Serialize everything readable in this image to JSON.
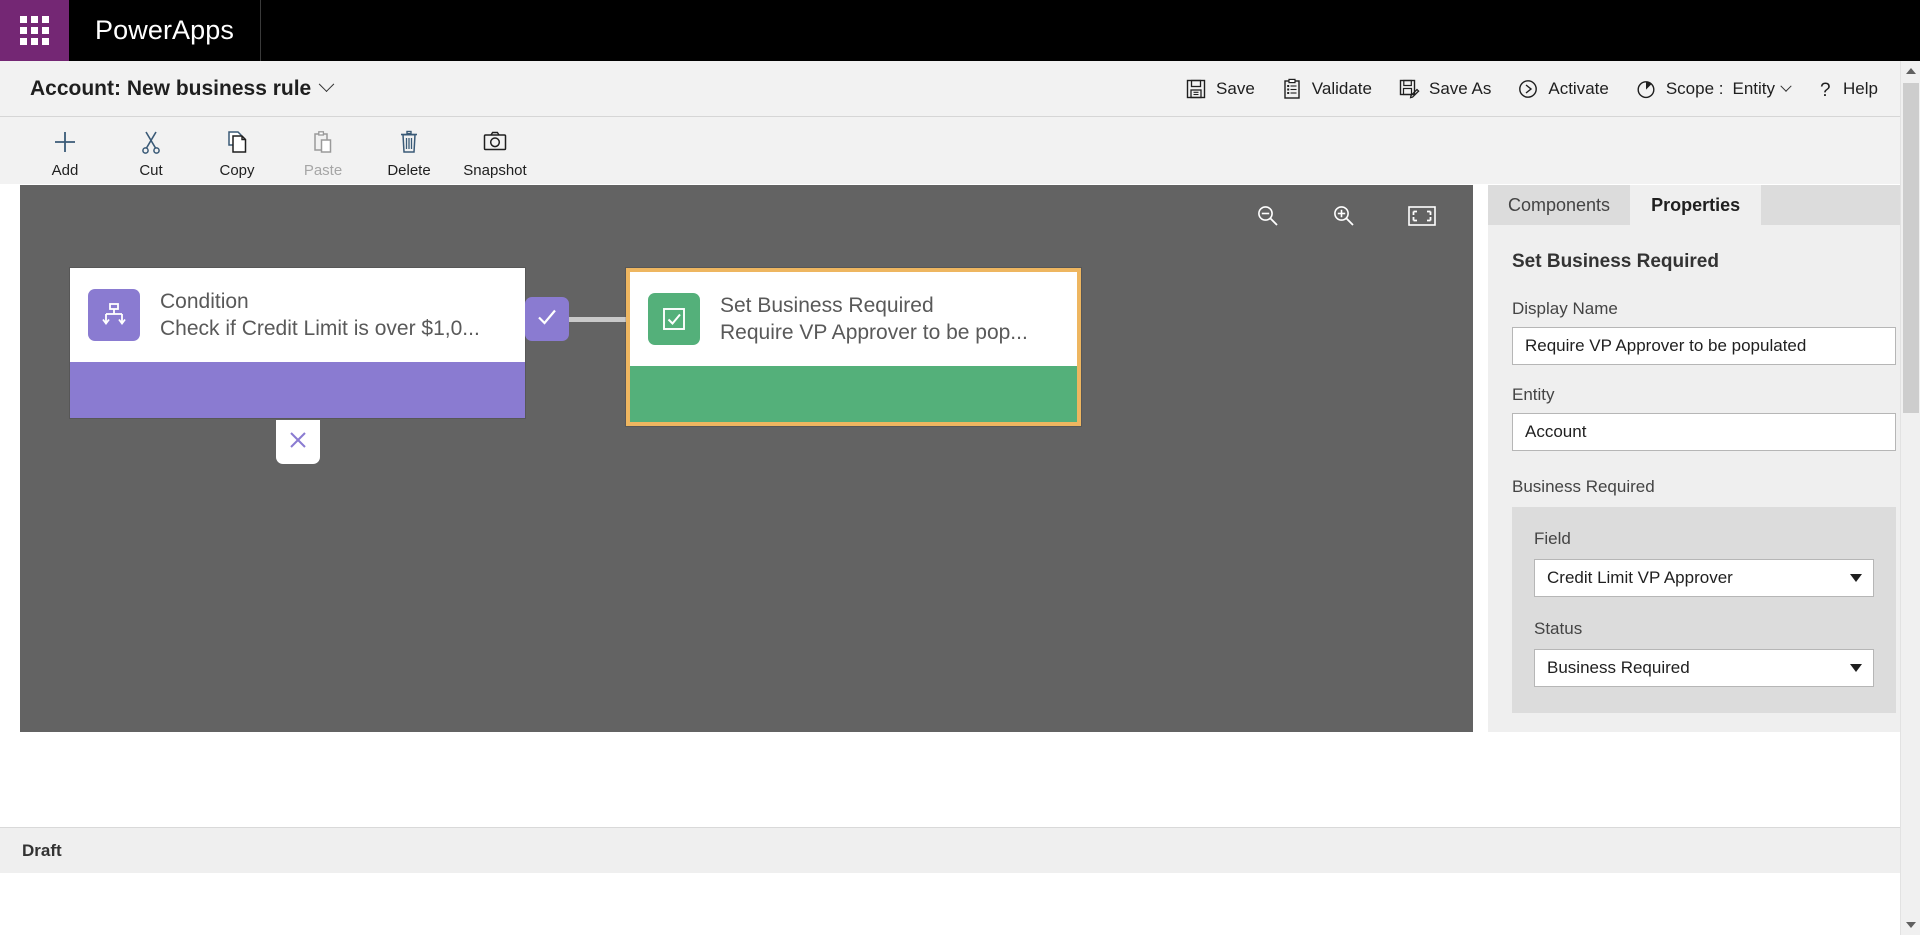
{
  "suite": {
    "waffle_icon": "waffle-grid-icon",
    "brand": "PowerApps",
    "brand_bg": "#000000",
    "waffle_bg": "#742774"
  },
  "command_bar": {
    "title": "Account: New business rule",
    "title_chevron_icon": "chevron-down-icon",
    "actions": [
      {
        "label": "Save",
        "icon": "save-disk-icon"
      },
      {
        "label": "Validate",
        "icon": "clipboard-check-icon"
      },
      {
        "label": "Save As",
        "icon": "save-as-icon"
      },
      {
        "label": "Activate",
        "icon": "play-circle-icon"
      }
    ],
    "scope": {
      "icon": "clock-pie-icon",
      "label": "Scope :",
      "value": "Entity",
      "chevron_icon": "chevron-down-icon"
    },
    "help": {
      "icon": "question-mark-icon",
      "label": "Help"
    }
  },
  "ribbon": {
    "buttons": [
      {
        "label": "Add",
        "icon": "plus-icon",
        "disabled": false
      },
      {
        "label": "Cut",
        "icon": "scissors-icon",
        "disabled": false
      },
      {
        "label": "Copy",
        "icon": "copy-pages-icon",
        "disabled": false
      },
      {
        "label": "Paste",
        "icon": "clipboard-paste-icon",
        "disabled": true
      },
      {
        "label": "Delete",
        "icon": "trash-can-icon",
        "disabled": false
      },
      {
        "label": "Snapshot",
        "icon": "camera-icon",
        "disabled": false
      }
    ]
  },
  "canvas": {
    "background": "#636363",
    "tools": [
      {
        "name": "zoom-out",
        "icon": "magnifier-minus-icon"
      },
      {
        "name": "zoom-in",
        "icon": "magnifier-plus-icon"
      },
      {
        "name": "fit-to-screen",
        "icon": "fit-screen-icon"
      }
    ],
    "nodes": [
      {
        "id": "condition",
        "icon": "branch-hierarchy-icon",
        "title": "Condition",
        "subtitle": "Check if Credit Limit is over $1,0...",
        "color": "#8a7bd1",
        "selected": false
      },
      {
        "id": "action",
        "icon": "checkbox-checked-icon",
        "title": "Set Business Required",
        "subtitle": "Require VP Approver to be pop...",
        "color": "#54b07a",
        "selected": true,
        "selection_color": "#eeb660"
      }
    ],
    "branches": [
      {
        "name": "true-branch",
        "icon": "check-icon",
        "fill": "#8a7bd1",
        "glyph_color": "#ffffff"
      },
      {
        "name": "false-branch",
        "icon": "close-x-icon",
        "fill": "#ffffff",
        "glyph_color": "#8a7bd1"
      }
    ]
  },
  "pane": {
    "tabs": [
      {
        "label": "Components",
        "active": false
      },
      {
        "label": "Properties",
        "active": true
      }
    ],
    "heading": "Set Business Required",
    "fields": [
      {
        "label": "Display Name",
        "value": "Require VP Approver to be populated",
        "type": "text"
      },
      {
        "label": "Entity",
        "value": "Account",
        "type": "text"
      }
    ],
    "group": {
      "label": "Business Required",
      "selects": [
        {
          "label": "Field",
          "value": "Credit Limit VP Approver",
          "caret_icon": "caret-down-icon"
        },
        {
          "label": "Status",
          "value": "Business Required",
          "caret_icon": "caret-down-icon"
        }
      ]
    }
  },
  "status_bar": {
    "text": "Draft"
  },
  "page_scrollbar": {
    "up_icon": "scroll-up-arrow-icon",
    "down_icon": "scroll-down-arrow-icon",
    "thumb": "scroll-thumb"
  }
}
